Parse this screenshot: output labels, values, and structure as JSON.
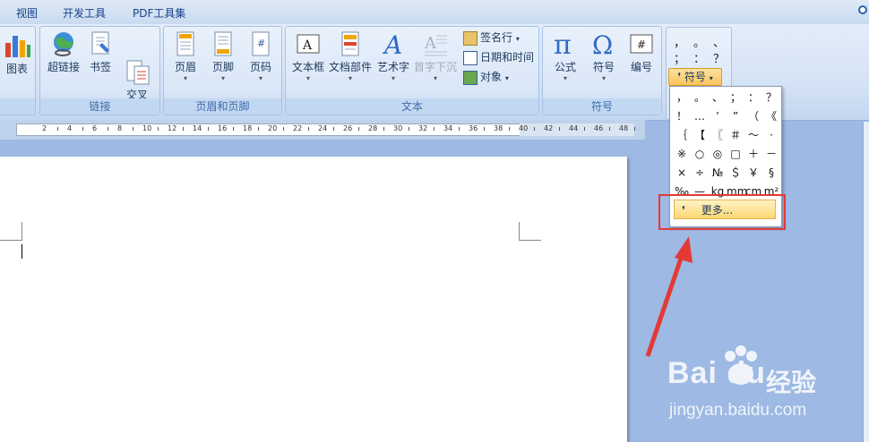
{
  "menu": [
    "视图",
    "开发工具",
    "PDF工具集"
  ],
  "groups": {
    "links": {
      "label": "链接",
      "buttons": [
        "超链接",
        "书签",
        "交叉\n引用"
      ]
    },
    "header_footer": {
      "label": "页眉和页脚",
      "buttons": [
        "页眉",
        "页脚",
        "页码"
      ]
    },
    "text": {
      "label": "文本",
      "buttons": [
        "文本框",
        "文档部件",
        "艺术字",
        "首字下沉"
      ],
      "small": [
        "签名行",
        "日期和时间",
        "对象"
      ]
    },
    "symbols": {
      "label": "符号",
      "buttons": [
        "公式",
        "符号",
        "编号"
      ]
    },
    "chart_partial": "图表"
  },
  "symbol_panel": {
    "button": "符号",
    "row1": [
      "，",
      "。",
      "、"
    ],
    "row2": [
      "；",
      "：",
      "？"
    ]
  },
  "dropdown": {
    "rows": [
      [
        "，",
        "。",
        "、",
        "；",
        "：",
        "？"
      ],
      [
        "！",
        "…",
        "’",
        "”",
        "（",
        "《"
      ],
      [
        "｛",
        "【",
        "〖",
        "＃",
        "～",
        "·"
      ],
      [
        "※",
        "○",
        "◎",
        "□",
        "＋",
        "－"
      ],
      [
        "×",
        "÷",
        "№",
        "＄",
        "￥",
        "§"
      ],
      [
        "‰",
        "—",
        "kg",
        "mm",
        "cm",
        "m²"
      ]
    ],
    "more": "更多..."
  },
  "ruler": [
    "2",
    "4",
    "6",
    "8",
    "10",
    "12",
    "14",
    "16",
    "18",
    "20",
    "22",
    "24",
    "26",
    "28",
    "30",
    "32",
    "34",
    "36",
    "38",
    "40",
    "42",
    "44",
    "46",
    "48"
  ],
  "watermark": {
    "brand": "Bai du",
    "cn": "经验",
    "url": "jingyan.baidu.com"
  },
  "colors": {
    "highlight": "#e53935",
    "ribbon": "#dae7f8"
  }
}
